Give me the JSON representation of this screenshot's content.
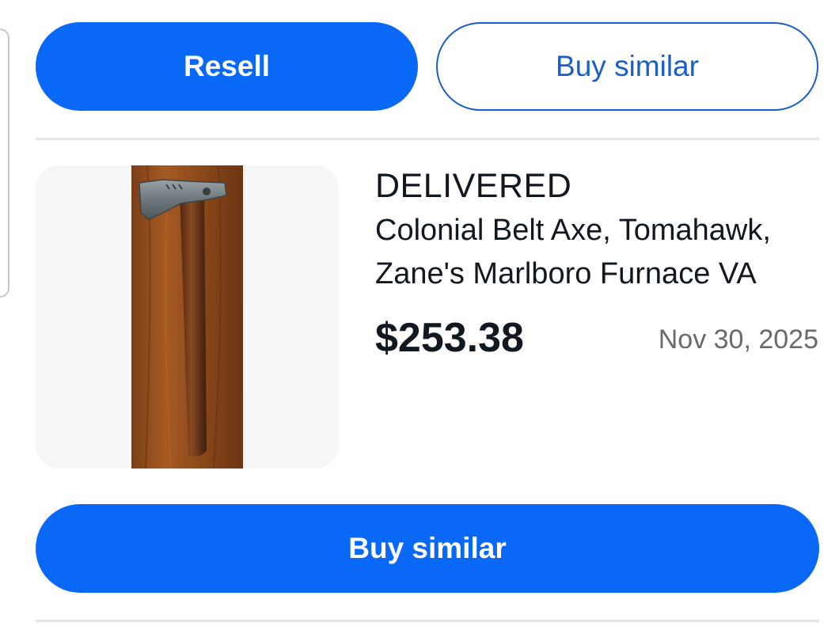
{
  "actions_top": {
    "resell_label": "Resell",
    "buy_similar_label": "Buy similar"
  },
  "order": {
    "status": "DELIVERED",
    "title": "Colonial Belt Axe,  Tomahawk, Zane's Marlboro Furnace VA",
    "price": "$253.38",
    "date": "Nov 30, 2025",
    "thumbnail_icon": "tomahawk-axe-photo"
  },
  "actions_bottom": {
    "buy_similar_label": "Buy similar"
  },
  "colors": {
    "primary": "#0968f6",
    "secondary_outline": "#1a5fc8",
    "text": "#111820",
    "muted_text": "#6a6a6a",
    "divider": "#e6e6e6",
    "thumbnail_bg": "#f6f6f6"
  }
}
